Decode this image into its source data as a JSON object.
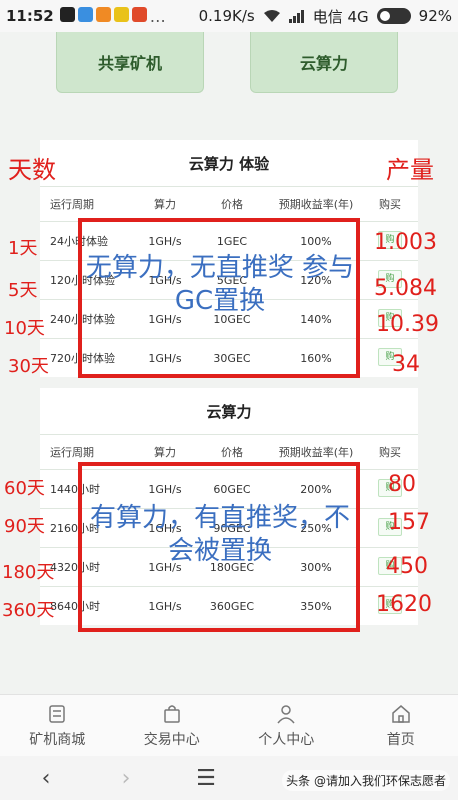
{
  "status": {
    "time": "11:52",
    "speed": "0.19K/s",
    "carrier": "电信 4G",
    "battery": "92%"
  },
  "top_buttons": [
    "共享矿机",
    "云算力"
  ],
  "trial": {
    "title": "云算力 体验",
    "headers": [
      "运行周期",
      "算力",
      "价格",
      "预期收益率(年)",
      "购买"
    ],
    "rows": [
      {
        "period": "24小时体验",
        "power": "1GH/s",
        "price": "1GEC",
        "rate": "100%",
        "buy": "购"
      },
      {
        "period": "120小时体验",
        "power": "1GH/s",
        "price": "5GEC",
        "rate": "120%",
        "buy": "购"
      },
      {
        "period": "240小时体验",
        "power": "1GH/s",
        "price": "10GEC",
        "rate": "140%",
        "buy": "购"
      },
      {
        "period": "720小时体验",
        "power": "1GH/s",
        "price": "30GEC",
        "rate": "160%",
        "buy": "购"
      }
    ]
  },
  "cloud": {
    "title": "云算力",
    "headers": [
      "运行周期",
      "算力",
      "价格",
      "预期收益率(年)",
      "购买"
    ],
    "rows": [
      {
        "period": "1440小时",
        "power": "1GH/s",
        "price": "60GEC",
        "rate": "200%",
        "buy": "购"
      },
      {
        "period": "2160小时",
        "power": "1GH/s",
        "price": "90GEC",
        "rate": "250%",
        "buy": "购"
      },
      {
        "period": "4320小时",
        "power": "1GH/s",
        "price": "180GEC",
        "rate": "300%",
        "buy": "购"
      },
      {
        "period": "8640小时",
        "power": "1GH/s",
        "price": "360GEC",
        "rate": "350%",
        "buy": "购"
      }
    ]
  },
  "annotations": {
    "days_label": "天数",
    "output_label": "产量",
    "trial_days": [
      "1天",
      "5天",
      "10天",
      "30天"
    ],
    "trial_output": [
      "1.003",
      "5.084",
      "10.39",
      "34"
    ],
    "cloud_days": [
      "60天",
      "90天",
      "180天",
      "360天"
    ],
    "cloud_output": [
      "80",
      "157",
      "450",
      "1620"
    ],
    "trial_note": "无算力，无直推奖 参与GC置换",
    "cloud_note": "有算力，有直推奖，不会被置换"
  },
  "nav": [
    "矿机商城",
    "交易中心",
    "个人中心",
    "首页"
  ],
  "system_nav": {
    "back": "‹",
    "forward": "›",
    "menu": "☰"
  },
  "watermark": "头条 @请加入我们环保志愿者"
}
